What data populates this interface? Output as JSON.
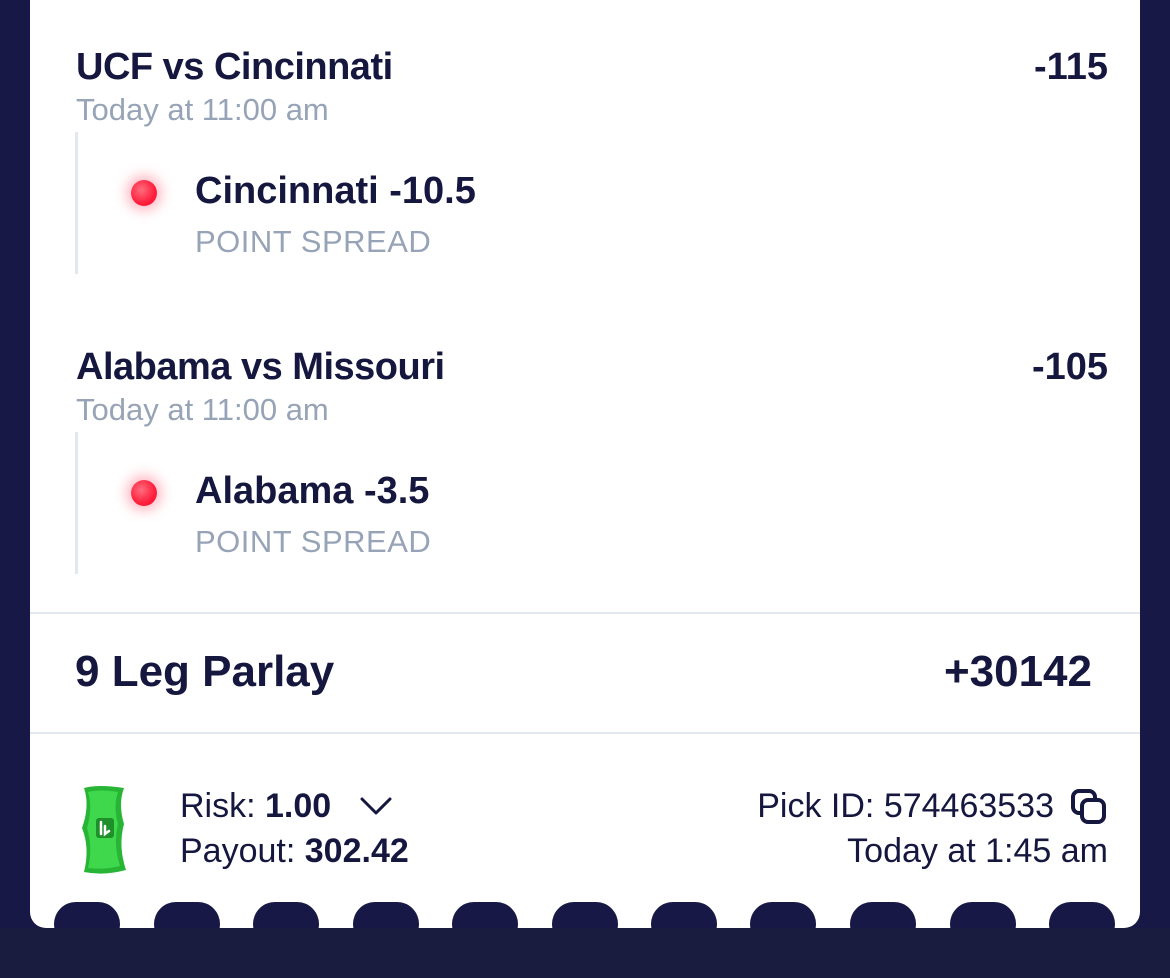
{
  "legs": [
    {
      "matchup": "UCF vs Cincinnati",
      "odds": "-115",
      "time": "Today at 11:00 am",
      "pick": "Cincinnati -10.5",
      "market": "POINT SPREAD",
      "status_color": "#ff2442"
    },
    {
      "matchup": "Alabama vs Missouri",
      "odds": "-105",
      "time": "Today at 11:00 am",
      "pick": "Alabama -3.5",
      "market": "POINT SPREAD",
      "status_color": "#ff2442"
    }
  ],
  "parlay": {
    "title": "9 Leg Parlay",
    "odds": "+30142"
  },
  "footer": {
    "icon": "money-bill-icon",
    "risk_label": "Risk:",
    "risk_value": "1.00",
    "payout_label": "Payout:",
    "payout_value": "302.42",
    "pick_id_label": "Pick ID:",
    "pick_id_value": "574463533",
    "placed_time": "Today at 1:45 am"
  },
  "colors": {
    "background": "#171846",
    "text": "#15173f",
    "muted": "#97a3b6",
    "loss_dot": "#ff2442",
    "money_green": "#2ec43c"
  }
}
